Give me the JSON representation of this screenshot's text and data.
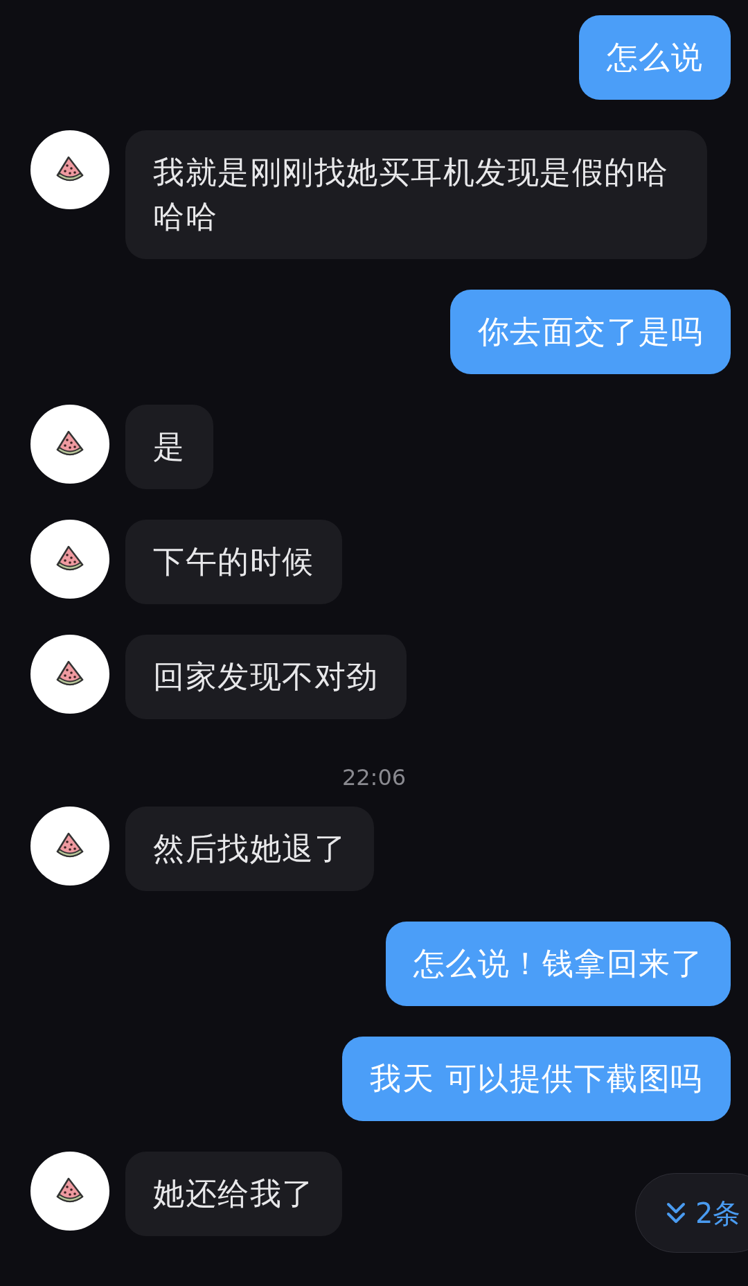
{
  "messages": [
    {
      "kind": "out",
      "text": "怎么说"
    },
    {
      "kind": "in",
      "text": "我就是刚刚找她买耳机发现是假的哈哈哈"
    },
    {
      "kind": "out",
      "text": "你去面交了是吗"
    },
    {
      "kind": "in",
      "text": "是"
    },
    {
      "kind": "in",
      "text": "下午的时候"
    },
    {
      "kind": "in",
      "text": "回家发现不对劲"
    },
    {
      "kind": "time",
      "text": "22:06"
    },
    {
      "kind": "in",
      "text": "然后找她退了"
    },
    {
      "kind": "out",
      "text": "怎么说！钱拿回来了"
    },
    {
      "kind": "out",
      "text": "我天 可以提供下截图吗"
    },
    {
      "kind": "in",
      "text": "她还给我了"
    }
  ],
  "new_messages_badge": {
    "text": "2条"
  }
}
